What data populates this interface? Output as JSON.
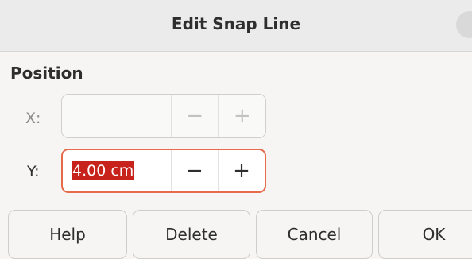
{
  "window": {
    "title": "Edit Snap Line"
  },
  "position": {
    "section_label": "Position",
    "x": {
      "label": "X:",
      "value": "",
      "minus": "−",
      "plus": "+"
    },
    "y": {
      "label": "Y:",
      "value": "4.00 cm",
      "minus": "−",
      "plus": "+"
    }
  },
  "buttons": {
    "help": "Help",
    "delete": "Delete",
    "cancel": "Cancel",
    "ok": "OK"
  },
  "colors": {
    "accent": "#e66a4c",
    "selection": "#c7221c"
  }
}
